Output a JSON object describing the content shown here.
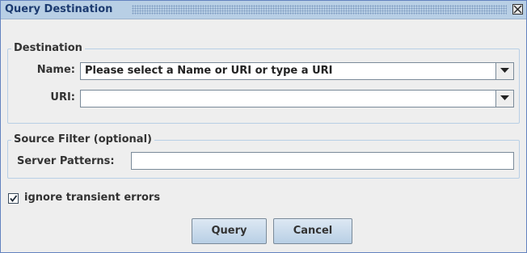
{
  "dialog": {
    "title": "Query Destination",
    "close_icon": "close-icon"
  },
  "destination": {
    "group_title": "Destination",
    "name_label": "Name:",
    "name_value": "Please select a Name or URI or type a URI",
    "uri_label": "URI:",
    "uri_value": "",
    "dropdown_icon": "chevron-down-icon"
  },
  "source_filter": {
    "group_title": "Source Filter (optional)",
    "server_patterns_label": "Server Patterns:",
    "server_patterns_value": ""
  },
  "options": {
    "ignore_transient_errors_label": "ignore transient errors",
    "ignore_transient_errors_checked": true
  },
  "buttons": {
    "query_label": "Query",
    "cancel_label": "Cancel"
  },
  "colors": {
    "titlebar": "#b8cfe5",
    "border_accent": "#6382bf",
    "button_gradient_top": "#dde8f3",
    "button_gradient_bottom": "#b8cfe5"
  }
}
